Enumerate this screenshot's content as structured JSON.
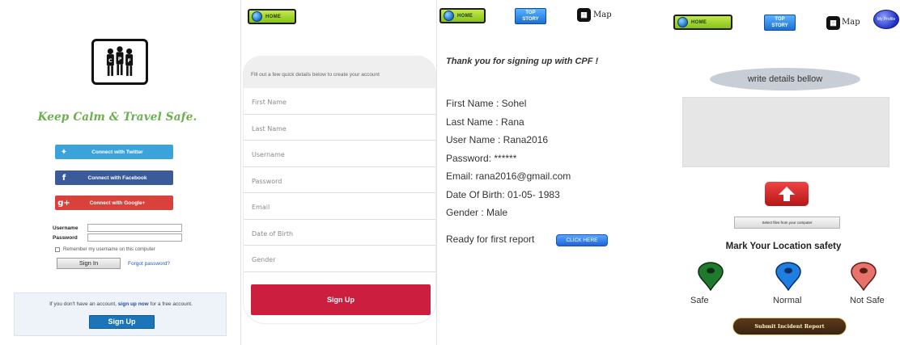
{
  "login": {
    "tagline": "Keep Calm & Travel Safe.",
    "twitter_label": "Connect with Twitter",
    "facebook_label": "Connect with Facebook",
    "google_label": "Connect with Google+",
    "username_label": "Username",
    "password_label": "Password",
    "remember_label": "Remember my username on this computer",
    "signin_label": "Sign In",
    "forgot_label": "Forgot password?",
    "no_account_prefix": "If you don't have an account,",
    "signup_now_link": "sign up now",
    "no_account_suffix": "for a free account.",
    "signup_label": "Sign Up",
    "logo_text": "CPF"
  },
  "signup_form": {
    "home_label": "HOME",
    "intro": "Fill out a few quick details below to create your account",
    "fields": [
      "First Name",
      "Last Name",
      "Username",
      "Password",
      "Email",
      "Date of Birth",
      "Gender"
    ],
    "submit_label": "Sign Up"
  },
  "confirmation": {
    "home_label": "HOME",
    "top_story_line1": "TOP",
    "top_story_line2": "STORY",
    "map_label": "Map",
    "thanks": "Thank you for signing up with CPF !",
    "details": [
      "First Name : Sohel",
      "Last Name : Rana",
      "User Name : Rana2016",
      "Password:  ******",
      "Email: rana2016@gmail.com",
      "Date Of Birth: 01-05- 1983",
      "Gender : Male"
    ],
    "report_prompt": "Ready for  first report",
    "click_here": "CLICK HERE"
  },
  "incident": {
    "home_label": "HOME",
    "top_story_line1": "TOP",
    "top_story_line2": "STORY",
    "map_label": "Map",
    "profile_label": "My Profile",
    "write_details": "write details bellow",
    "select_files": "Select files from your computer",
    "mark_title": "Mark Your Location safety",
    "safe_label": "Safe",
    "normal_label": "Normal",
    "not_safe_label": "Not Safe",
    "submit_label": "Submit Incident Report"
  },
  "colors": {
    "tagline_green": "#6ab04c",
    "twitter": "#3aa3dc",
    "facebook": "#3b5a9a",
    "google": "#d9413b",
    "signup_red": "#cc1e3e",
    "pin_safe": "#1f7a2e",
    "pin_normal": "#1e7fe0",
    "pin_not_safe": "#e8736a"
  },
  "icons": {
    "twitter": "twitter-bird-icon",
    "facebook": "facebook-f-icon",
    "google": "google-plus-icon",
    "home": "globe-icon",
    "map": "map-icon",
    "upload": "upload-arrow-icon",
    "pins": "map-pin-icon"
  }
}
